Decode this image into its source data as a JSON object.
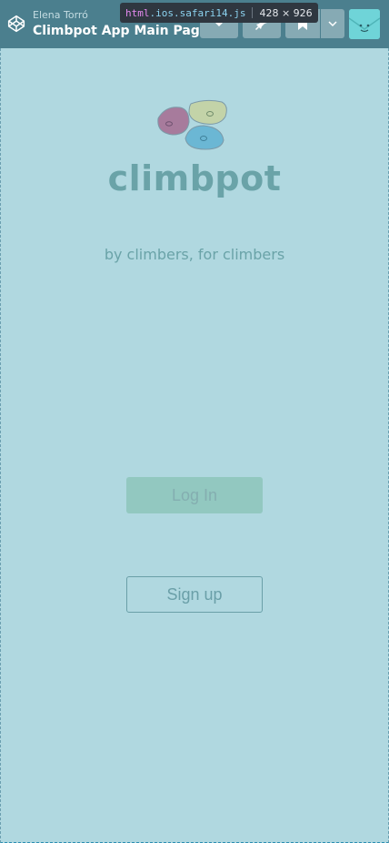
{
  "header": {
    "author": "Elena Torró",
    "title": "Climbpot App Main Page",
    "logo_icon": "codepen-icon",
    "buttons": [
      "chevron-down-icon",
      "pin-icon",
      "bookmark-icon",
      "chevron-down-icon"
    ]
  },
  "tooltip": {
    "tag": "html",
    "classname": ".ios.safari14.js",
    "dimensions": "428 × 926"
  },
  "app": {
    "brand": "climbpot",
    "tagline": "by climbers, for climbers",
    "login_label": "Log In",
    "signup_label": "Sign up"
  },
  "colors": {
    "background": "#b0d8e0",
    "header": "#4b7f8e",
    "brand": "#6aa3a8",
    "login_button": "#92c8c0",
    "hold_pink": "#a77b9c",
    "hold_yellow": "#c3d3a8",
    "hold_blue": "#6bb7d4"
  }
}
